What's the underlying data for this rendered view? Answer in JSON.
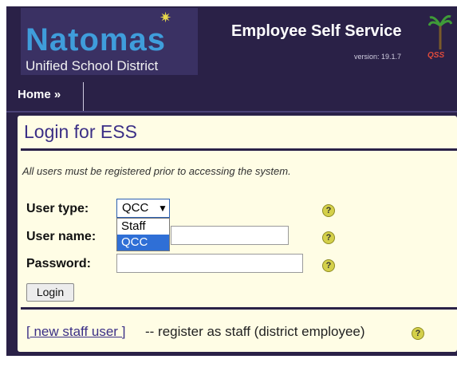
{
  "header": {
    "logo_main": "Natomas",
    "logo_sub": "Unified School District",
    "app_title": "Employee Self Service",
    "version": "version: 19.1.7",
    "brand": "QSS"
  },
  "nav": {
    "home": "Home »"
  },
  "page": {
    "title": "Login for ESS",
    "note": "All users must be registered prior to accessing the system."
  },
  "form": {
    "user_type_label": "User type:",
    "user_type_value": "QCC",
    "user_type_options": [
      "Staff",
      "QCC"
    ],
    "user_name_label": "User name:",
    "user_name_value": "",
    "password_label": "Password:",
    "password_value": "",
    "login_button": "Login",
    "help_glyph": "?"
  },
  "footer": {
    "new_staff_link": "[ new staff user ]",
    "new_staff_desc": "-- register as staff (district employee)"
  },
  "colors": {
    "banner": "#2a2147",
    "panel": "#fffde5",
    "title": "#3b2f86",
    "selected_option": "#2f6fd6"
  },
  "icons": [
    "star-icon",
    "palm-tree-icon",
    "help-icon",
    "dropdown-caret-icon"
  ]
}
